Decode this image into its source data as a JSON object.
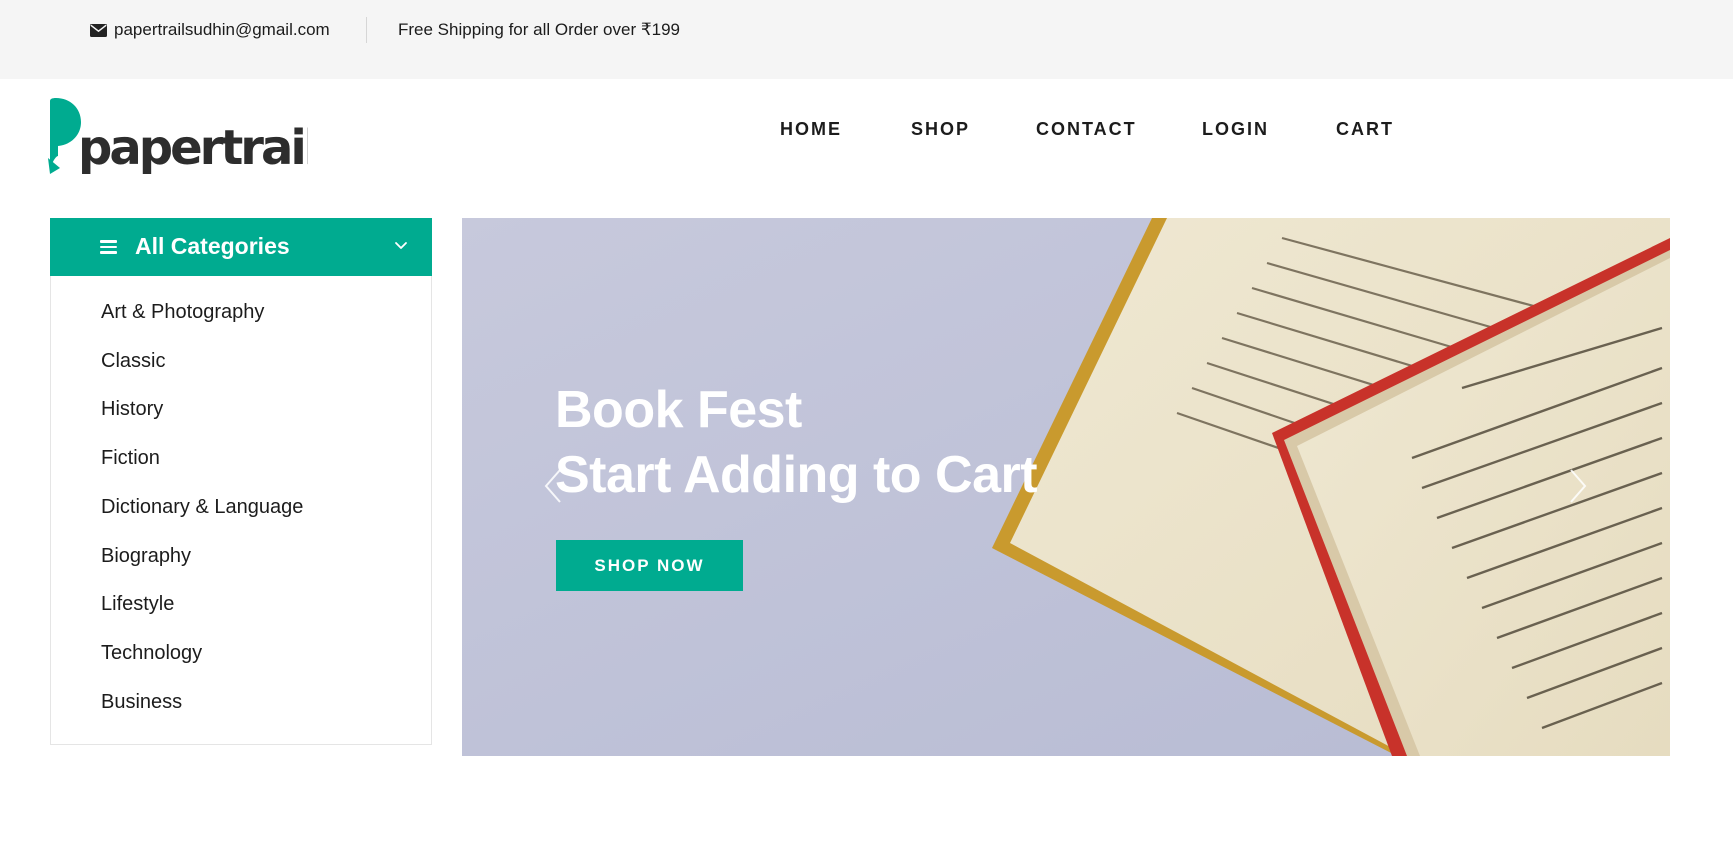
{
  "topbar": {
    "email": "papertrailsudhin@gmail.com",
    "shipping": "Free Shipping for all Order over ₹199"
  },
  "logo": {
    "text": "papertrail",
    "color": "#00ab90"
  },
  "nav": {
    "items": [
      {
        "label": "HOME"
      },
      {
        "label": "SHOP"
      },
      {
        "label": "CONTACT"
      },
      {
        "label": "LOGIN"
      },
      {
        "label": "CART"
      }
    ]
  },
  "categories": {
    "title": "All Categories",
    "items": [
      "Art & Photography",
      "Classic",
      "History",
      "Fiction",
      "Dictionary & Language",
      "Biography",
      "Lifestyle",
      "Technology",
      "Business"
    ]
  },
  "hero": {
    "line1": "Book Fest",
    "line2": "Start Adding to Cart",
    "button": "SHOP NOW"
  },
  "icons": {
    "mail": "envelope-icon",
    "menu": "hamburger-menu-icon",
    "chevron": "chevron-down-icon",
    "prev": "chevron-left-icon",
    "next": "chevron-right-icon"
  },
  "colors": {
    "accent": "#00ab90",
    "topbar_bg": "#f5f5f5",
    "text": "#1c1c1c"
  }
}
